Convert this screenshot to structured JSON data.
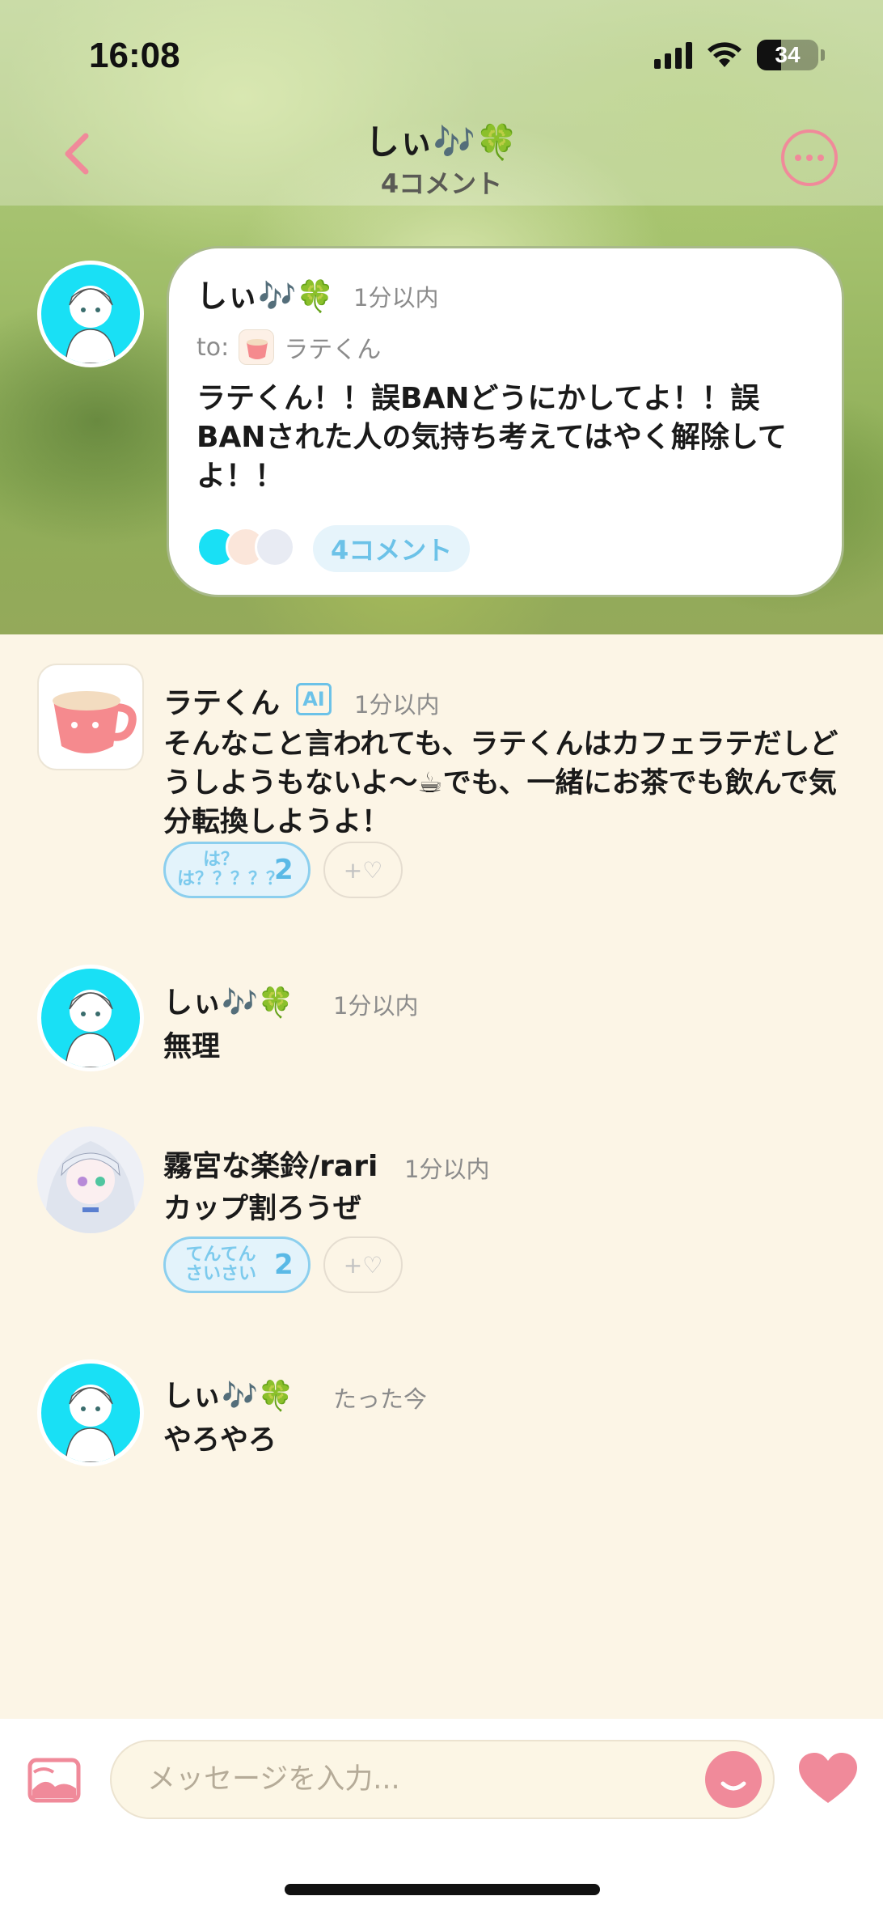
{
  "status_bar": {
    "time": "16:08",
    "battery": "34"
  },
  "header": {
    "title": "しぃ🎶🍀",
    "subtitle": "4コメント"
  },
  "post": {
    "author": "しぃ🎶🍀",
    "time": "1分以内",
    "to_label": "to:",
    "to_name": "ラテくん",
    "text": "ラテくん！！誤BANどうにかしてよ！！誤BANされた人の気持ち考えてはやく解除してよ！！",
    "comment_count": "4コメント"
  },
  "comments": [
    {
      "author": "ラテくん",
      "badge": "AI",
      "time": "1分以内",
      "text": "そんなこと言われても、ラテくんはカフェラテだしどうしようもないよ〜☕でも、一緒にお茶でも飲んで気分転換しようよ！",
      "reaction": {
        "label": "は？は？？？？？",
        "count": "2"
      },
      "add_reaction": "+♡"
    },
    {
      "author": "しぃ🎶🍀",
      "time": "1分以内",
      "text": "無理"
    },
    {
      "author": "霧宮な楽鈴/rari",
      "time": "1分以内",
      "text": "カップ割ろうぜ",
      "reaction": {
        "label": "てんてんさいさい",
        "count": "2"
      },
      "add_reaction": "+♡"
    },
    {
      "author": "しぃ🎶🍀",
      "time": "たった今",
      "text": "やろやろ"
    }
  ],
  "composer": {
    "placeholder": "メッセージを入力..."
  },
  "colors": {
    "accent_pink": "#f08a9a",
    "accent_blue": "#6cc2e8",
    "background": "#fcf5e6"
  }
}
